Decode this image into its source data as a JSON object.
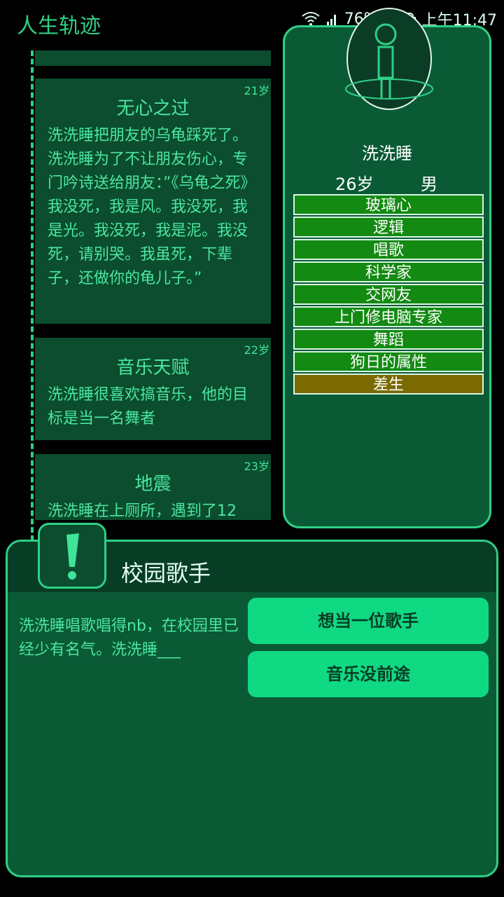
{
  "app": {
    "title": "人生轨迹"
  },
  "status": {
    "battery": "76%",
    "time": "上午11:47"
  },
  "timeline": [
    {
      "age": "21岁",
      "title": "无心之过",
      "text": "洗洗睡把朋友的乌龟踩死了。洗洗睡为了不让朋友伤心，专门吟诗送给朋友：”《乌龟之死》我没死，我是风。我没死，我是光。我没死，我是泥。我没死，请别哭。我虽死，下辈子，还做你的龟儿子。”"
    },
    {
      "age": "22岁",
      "title": "音乐天赋",
      "text": "洗洗睡很喜欢搞音乐，他的目标是当一名舞者"
    },
    {
      "age": "23岁",
      "title": "地震",
      "text": "洗洗睡在上厕所，遇到了12"
    }
  ],
  "profile": {
    "name": "洗洗睡",
    "age": "26岁",
    "gender": "男",
    "traits": [
      {
        "label": "玻璃心",
        "type": "good"
      },
      {
        "label": "逻辑",
        "type": "good"
      },
      {
        "label": "唱歌",
        "type": "good"
      },
      {
        "label": "科学家",
        "type": "good"
      },
      {
        "label": "交网友",
        "type": "good"
      },
      {
        "label": "上门修电脑专家",
        "type": "good"
      },
      {
        "label": "舞蹈",
        "type": "good"
      },
      {
        "label": "狗日的属性",
        "type": "good"
      },
      {
        "label": "差生",
        "type": "bad"
      }
    ]
  },
  "event": {
    "title": "校园歌手",
    "text": "洗洗睡唱歌唱得nb，在校园里已经少有名气。洗洗睡___",
    "choices": [
      "想当一位歌手",
      "音乐没前途"
    ]
  },
  "icons": {
    "wifi": "wifi-icon",
    "signal": "signal-icon",
    "battery": "battery-icon",
    "alert": "exclamation-icon",
    "avatar": "stick-figure-icon"
  },
  "colors": {
    "accent": "#2fcf86",
    "panel": "#0a5a36",
    "button": "#10d983",
    "trait_good": "#138a12",
    "trait_bad": "#7a6a00"
  }
}
